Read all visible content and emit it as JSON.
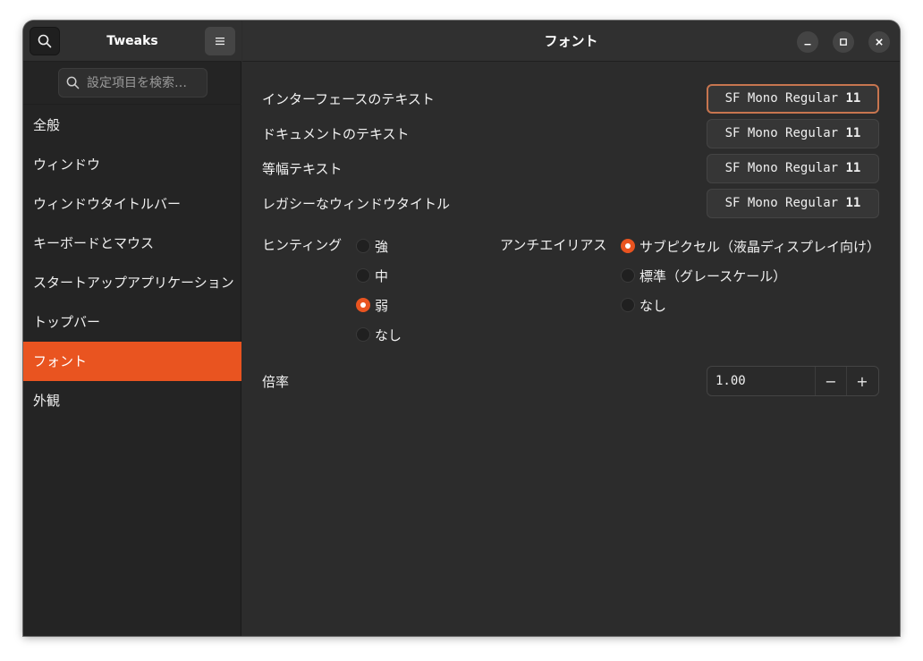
{
  "sidebar": {
    "title": "Tweaks",
    "search_placeholder": "設定項目を検索…",
    "items": [
      {
        "label": "全般"
      },
      {
        "label": "ウィンドウ"
      },
      {
        "label": "ウィンドウタイトルバー"
      },
      {
        "label": "キーボードとマウス"
      },
      {
        "label": "スタートアップアプリケーション"
      },
      {
        "label": "トップバー"
      },
      {
        "label": "フォント",
        "active": true
      },
      {
        "label": "外観"
      }
    ]
  },
  "header": {
    "title": "フォント"
  },
  "fonts": [
    {
      "label": "インターフェースのテキスト",
      "font": "SF Mono Regular",
      "size": "11"
    },
    {
      "label": "ドキュメントのテキスト",
      "font": "SF Mono Regular",
      "size": "11"
    },
    {
      "label": "等幅テキスト",
      "font": "SF Mono Regular",
      "size": "11"
    },
    {
      "label": "レガシーなウィンドウタイトル",
      "font": "SF Mono Regular",
      "size": "11"
    }
  ],
  "hinting": {
    "label": "ヒンティング",
    "options": [
      "強",
      "中",
      "弱",
      "なし"
    ],
    "selected": "弱"
  },
  "antialiasing": {
    "label": "アンチエイリアス",
    "options": [
      "サブピクセル（液晶ディスプレイ向け）",
      "標準（グレースケール）",
      "なし"
    ],
    "selected": "サブピクセル（液晶ディスプレイ向け）"
  },
  "scaling": {
    "label": "倍率",
    "value": "1.00",
    "minus": "−",
    "plus": "+"
  },
  "colors": {
    "accent": "#e95420",
    "window_bg": "#2c2c2c",
    "sidebar_bg": "#242424"
  }
}
